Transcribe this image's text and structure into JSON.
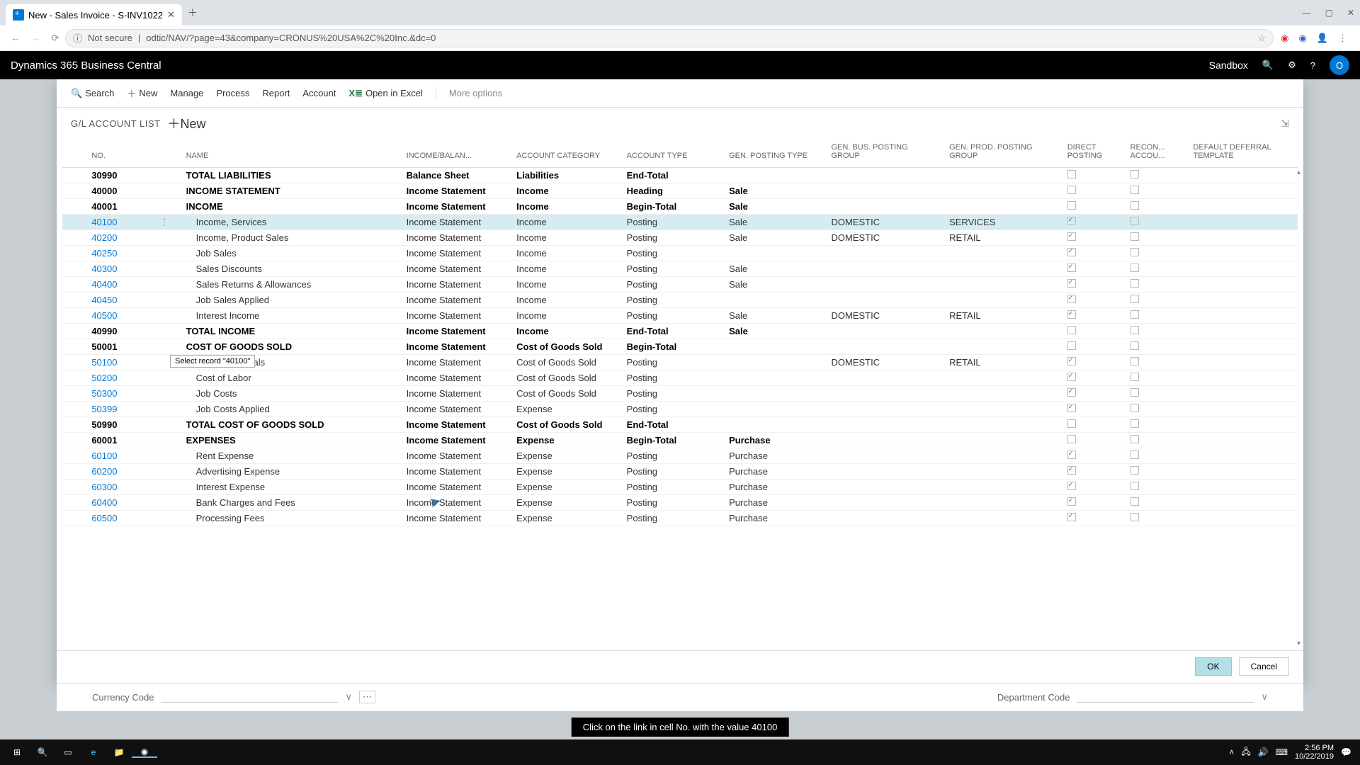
{
  "browser": {
    "tab_title": "New - Sales Invoice - S-INV1022",
    "url_security": "Not secure",
    "url": "odtic/NAV/?page=43&company=CRONUS%20USA%2C%20Inc.&dc=0"
  },
  "app": {
    "title": "Dynamics 365 Business Central",
    "env": "Sandbox",
    "avatar": "O"
  },
  "toolbar": {
    "search": "Search",
    "new": "New",
    "manage": "Manage",
    "process": "Process",
    "report": "Report",
    "account": "Account",
    "excel": "Open in Excel",
    "more": "More options"
  },
  "modal": {
    "breadcrumb": "G/L ACCOUNT LIST",
    "new": "New",
    "tooltip": "Select record \"40100\"",
    "ok": "OK",
    "cancel": "Cancel"
  },
  "columns": {
    "no": "NO.",
    "name": "NAME",
    "income_balance": "INCOME/BALAN...",
    "account_category": "ACCOUNT CATEGORY",
    "account_type": "ACCOUNT TYPE",
    "gen_posting_type": "GEN. POSTING TYPE",
    "gen_bus_posting_group": "GEN. BUS. POSTING GROUP",
    "gen_prod_posting_group": "GEN. PROD. POSTING GROUP",
    "direct_posting": "DIRECT POSTING",
    "recon": "RECON... ACCOU...",
    "deferral": "DEFAULT DEFERRAL TEMPLATE"
  },
  "rows": [
    {
      "no": "30990",
      "name": "TOTAL LIABILITIES",
      "ib": "Balance Sheet",
      "cat": "Liabilities",
      "type": "End-Total",
      "gpt": "",
      "gbp": "",
      "gpp": "",
      "dp": false,
      "bold": true,
      "sel": false
    },
    {
      "no": "40000",
      "name": "INCOME STATEMENT",
      "ib": "Income Statement",
      "cat": "Income",
      "type": "Heading",
      "gpt": "Sale",
      "gbp": "",
      "gpp": "",
      "dp": false,
      "bold": true,
      "sel": false
    },
    {
      "no": "40001",
      "name": "INCOME",
      "ib": "Income Statement",
      "cat": "Income",
      "type": "Begin-Total",
      "gpt": "Sale",
      "gbp": "",
      "gpp": "",
      "dp": false,
      "bold": true,
      "sel": false
    },
    {
      "no": "40100",
      "name": "Income, Services",
      "ib": "Income Statement",
      "cat": "Income",
      "type": "Posting",
      "gpt": "Sale",
      "gbp": "DOMESTIC",
      "gpp": "SERVICES",
      "dp": true,
      "bold": false,
      "sel": true,
      "indent": true
    },
    {
      "no": "40200",
      "name": "Income, Product Sales",
      "ib": "Income Statement",
      "cat": "Income",
      "type": "Posting",
      "gpt": "Sale",
      "gbp": "DOMESTIC",
      "gpp": "RETAIL",
      "dp": true,
      "bold": false,
      "sel": false,
      "indent": true
    },
    {
      "no": "40250",
      "name": "Job Sales",
      "ib": "Income Statement",
      "cat": "Income",
      "type": "Posting",
      "gpt": "",
      "gbp": "",
      "gpp": "",
      "dp": true,
      "bold": false,
      "sel": false,
      "indent": true
    },
    {
      "no": "40300",
      "name": "Sales Discounts",
      "ib": "Income Statement",
      "cat": "Income",
      "type": "Posting",
      "gpt": "Sale",
      "gbp": "",
      "gpp": "",
      "dp": true,
      "bold": false,
      "sel": false,
      "indent": true
    },
    {
      "no": "40400",
      "name": "Sales Returns & Allowances",
      "ib": "Income Statement",
      "cat": "Income",
      "type": "Posting",
      "gpt": "Sale",
      "gbp": "",
      "gpp": "",
      "dp": true,
      "bold": false,
      "sel": false,
      "indent": true
    },
    {
      "no": "40450",
      "name": "Job Sales Applied",
      "ib": "Income Statement",
      "cat": "Income",
      "type": "Posting",
      "gpt": "",
      "gbp": "",
      "gpp": "",
      "dp": true,
      "bold": false,
      "sel": false,
      "indent": true
    },
    {
      "no": "40500",
      "name": "Interest Income",
      "ib": "Income Statement",
      "cat": "Income",
      "type": "Posting",
      "gpt": "Sale",
      "gbp": "DOMESTIC",
      "gpp": "RETAIL",
      "dp": true,
      "bold": false,
      "sel": false,
      "indent": true
    },
    {
      "no": "40990",
      "name": "TOTAL INCOME",
      "ib": "Income Statement",
      "cat": "Income",
      "type": "End-Total",
      "gpt": "Sale",
      "gbp": "",
      "gpp": "",
      "dp": false,
      "bold": true,
      "sel": false
    },
    {
      "no": "50001",
      "name": "COST OF GOODS SOLD",
      "ib": "Income Statement",
      "cat": "Cost of Goods Sold",
      "type": "Begin-Total",
      "gpt": "",
      "gbp": "",
      "gpp": "",
      "dp": false,
      "bold": true,
      "sel": false
    },
    {
      "no": "50100",
      "name": "Cost of Materials",
      "ib": "Income Statement",
      "cat": "Cost of Goods Sold",
      "type": "Posting",
      "gpt": "",
      "gbp": "DOMESTIC",
      "gpp": "RETAIL",
      "dp": true,
      "bold": false,
      "sel": false,
      "indent": true
    },
    {
      "no": "50200",
      "name": "Cost of Labor",
      "ib": "Income Statement",
      "cat": "Cost of Goods Sold",
      "type": "Posting",
      "gpt": "",
      "gbp": "",
      "gpp": "",
      "dp": true,
      "bold": false,
      "sel": false,
      "indent": true
    },
    {
      "no": "50300",
      "name": "Job Costs",
      "ib": "Income Statement",
      "cat": "Cost of Goods Sold",
      "type": "Posting",
      "gpt": "",
      "gbp": "",
      "gpp": "",
      "dp": true,
      "bold": false,
      "sel": false,
      "indent": true
    },
    {
      "no": "50399",
      "name": "Job Costs Applied",
      "ib": "Income Statement",
      "cat": "Expense",
      "type": "Posting",
      "gpt": "",
      "gbp": "",
      "gpp": "",
      "dp": true,
      "bold": false,
      "sel": false,
      "indent": true
    },
    {
      "no": "50990",
      "name": "TOTAL COST OF GOODS SOLD",
      "ib": "Income Statement",
      "cat": "Cost of Goods Sold",
      "type": "End-Total",
      "gpt": "",
      "gbp": "",
      "gpp": "",
      "dp": false,
      "bold": true,
      "sel": false
    },
    {
      "no": "60001",
      "name": "EXPENSES",
      "ib": "Income Statement",
      "cat": "Expense",
      "type": "Begin-Total",
      "gpt": "Purchase",
      "gbp": "",
      "gpp": "",
      "dp": false,
      "bold": true,
      "sel": false
    },
    {
      "no": "60100",
      "name": "Rent Expense",
      "ib": "Income Statement",
      "cat": "Expense",
      "type": "Posting",
      "gpt": "Purchase",
      "gbp": "",
      "gpp": "",
      "dp": true,
      "bold": false,
      "sel": false,
      "indent": true
    },
    {
      "no": "60200",
      "name": "Advertising Expense",
      "ib": "Income Statement",
      "cat": "Expense",
      "type": "Posting",
      "gpt": "Purchase",
      "gbp": "",
      "gpp": "",
      "dp": true,
      "bold": false,
      "sel": false,
      "indent": true
    },
    {
      "no": "60300",
      "name": "Interest Expense",
      "ib": "Income Statement",
      "cat": "Expense",
      "type": "Posting",
      "gpt": "Purchase",
      "gbp": "",
      "gpp": "",
      "dp": true,
      "bold": false,
      "sel": false,
      "indent": true
    },
    {
      "no": "60400",
      "name": "Bank Charges and Fees",
      "ib": "Income Statement",
      "cat": "Expense",
      "type": "Posting",
      "gpt": "Purchase",
      "gbp": "",
      "gpp": "",
      "dp": true,
      "bold": false,
      "sel": false,
      "indent": true
    },
    {
      "no": "60500",
      "name": "Processing Fees",
      "ib": "Income Statement",
      "cat": "Expense",
      "type": "Posting",
      "gpt": "Purchase",
      "gbp": "",
      "gpp": "",
      "dp": true,
      "bold": false,
      "sel": false,
      "indent": true
    }
  ],
  "fields": {
    "currency": "Currency Code",
    "department": "Department Code"
  },
  "instruction": "Click on the link in cell No. with the value 40100",
  "taskbar": {
    "time": "2:56 PM",
    "date": "10/22/2019"
  }
}
